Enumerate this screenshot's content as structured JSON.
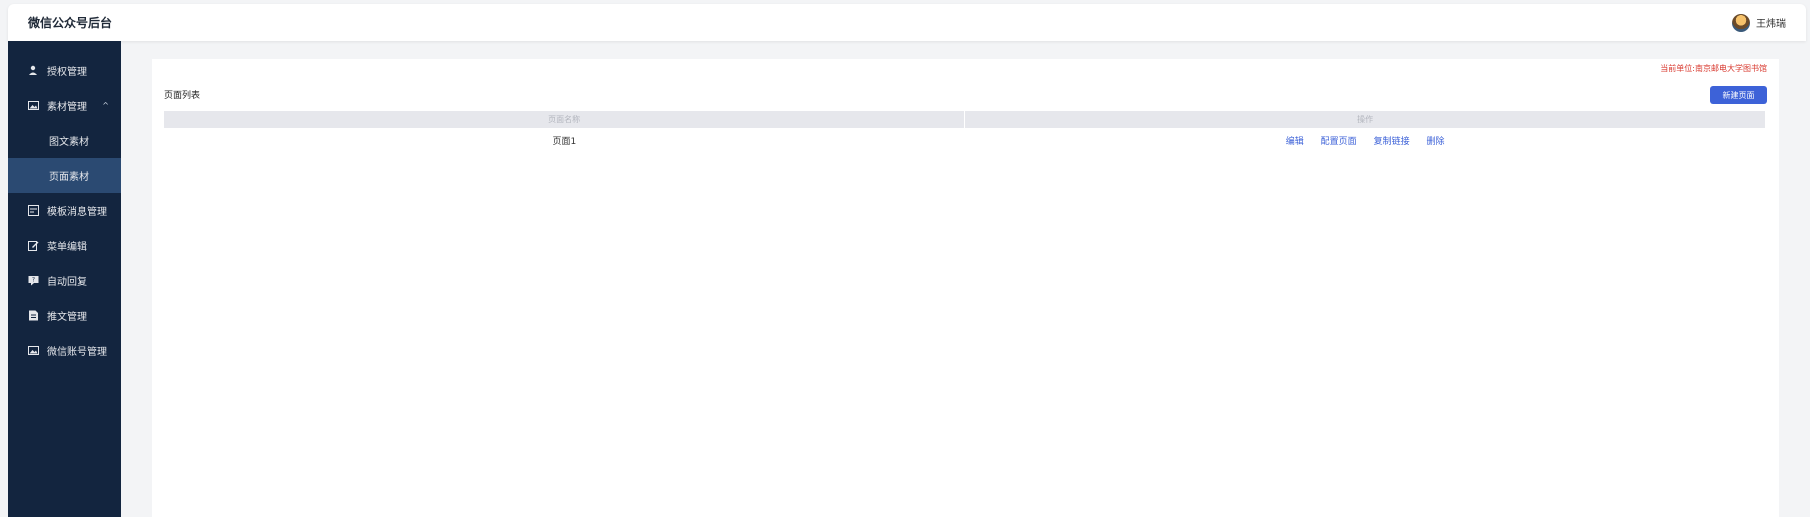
{
  "header": {
    "title": "微信公众号后台",
    "user_name": "王炜瑞"
  },
  "sidebar": {
    "items": [
      {
        "label": "授权管理",
        "icon": "user-icon"
      },
      {
        "label": "素材管理",
        "icon": "image-icon",
        "expanded": true
      },
      {
        "label": "图文素材",
        "sub": true
      },
      {
        "label": "页面素材",
        "sub": true,
        "active": true
      },
      {
        "label": "模板消息管理",
        "icon": "template-icon"
      },
      {
        "label": "菜单编辑",
        "icon": "edit-icon"
      },
      {
        "label": "自动回复",
        "icon": "reply-icon"
      },
      {
        "label": "推文管理",
        "icon": "document-icon"
      },
      {
        "label": "微信账号管理",
        "icon": "account-icon"
      }
    ]
  },
  "main": {
    "unit_notice": "当前单位:南京邮电大学图书馆",
    "list_title": "页面列表",
    "new_button": "新建页面",
    "table": {
      "columns": [
        "页面名称",
        "操作"
      ],
      "rows": [
        {
          "name": "页面1",
          "actions": [
            "编辑",
            "配置页面",
            "复制链接",
            "删除"
          ]
        }
      ]
    }
  },
  "colors": {
    "sidebar_bg": "#13253f",
    "sidebar_active": "#2b4a72",
    "primary": "#3d62d8",
    "notice_red": "#d8382e"
  }
}
